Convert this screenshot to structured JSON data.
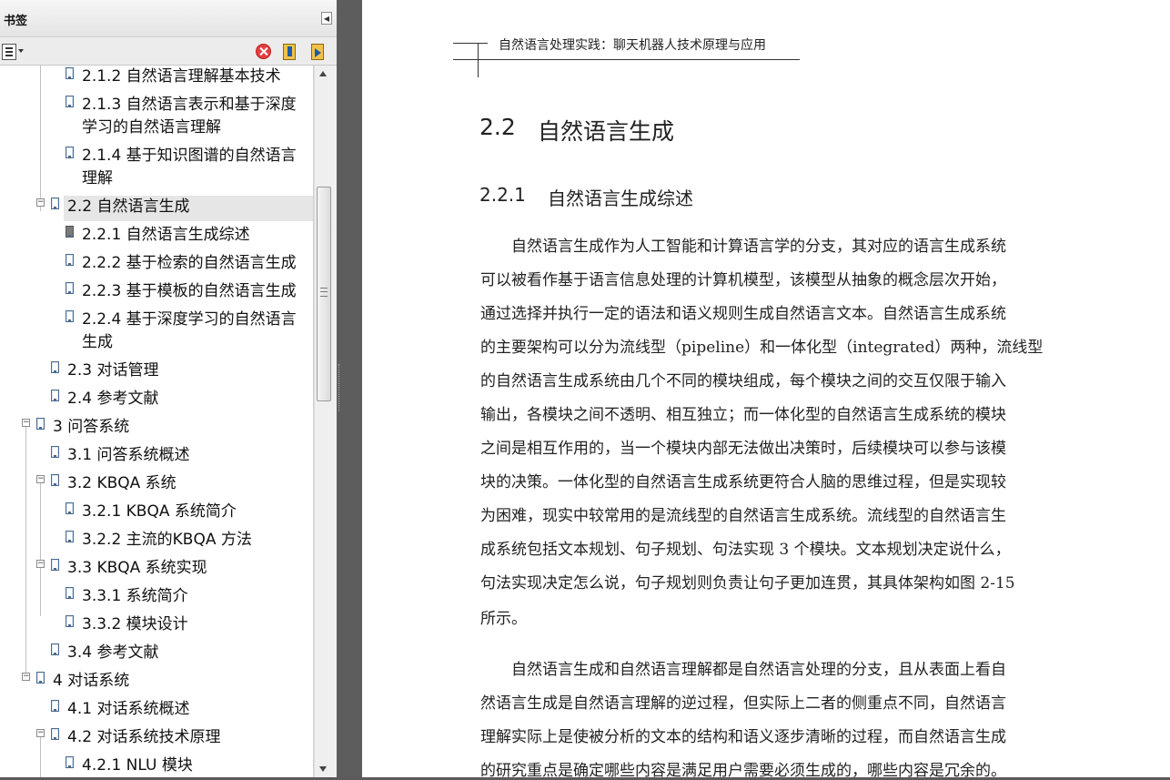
{
  "bookmarks_panel": {
    "title": "书签",
    "tree_lines": [
      "2.1.2 自然语言理解基本技术",
      "2.1.3 自然语言表示和基于深度",
      "学习的自然语言理解",
      "2.1.4 基于知识图谱的自然语言",
      "理解",
      "2.2 自然语言生成",
      "2.2.1 自然语言生成综述",
      "2.2.2 基于检索的自然语言生成",
      "2.2.3 基于模板的自然语言生成",
      "2.2.4 基于深度学习的自然语言",
      "生成",
      "2.3 对话管理",
      "2.4 参考文献",
      "3 问答系统",
      "3.1 问答系统概述",
      "3.2 KBQA 系统",
      "3.2.1 KBQA 系统简介",
      "3.2.2 主流的KBQA 方法",
      "3.3 KBQA 系统实现",
      "3.3.1 系统简介",
      "3.3.2 模块设计",
      "3.4 参考文献",
      "4 对话系统",
      "4.1 对话系统概述",
      "4.2 对话系统技术原理",
      "4.2.1 NLU 模块"
    ]
  },
  "document": {
    "running_header": "自然语言处理实践：聊天机器人技术原理与应用",
    "section_number": "2.2",
    "section_title": "自然语言生成",
    "subsection_number": "2.2.1",
    "subsection_title": "自然语言生成综述",
    "paragraph_lines": [
      "　　自然语言生成作为人工智能和计算语言学的分支，其对应的语言生成系统",
      "可以被看作基于语言信息处理的计算机模型，该模型从抽象的概念层次开始，",
      "通过选择并执行一定的语法和语义规则生成自然语言文本。自然语言生成系统",
      "的主要架构可以分为流线型（pipeline）和一体化型（integrated）两种，流线型",
      "的自然语言生成系统由几个不同的模块组成，每个模块之间的交互仅限于输入",
      "输出，各模块之间不透明、相互独立；而一体化型的自然语言生成系统的模块",
      "之间是相互作用的，当一个模块内部无法做出决策时，后续模块可以参与该模",
      "块的决策。一体化型的自然语言生成系统更符合人脑的思维过程，但是实现较",
      "为困难，现实中较常用的是流线型的自然语言生成系统。流线型的自然语言生",
      "成系统包括文本规划、句子规划、句法实现 3 个模块。文本规划决定说什么，",
      "句法实现决定怎么说，句子规划则负责让句子更加连贯，其具体架构如图 2-15",
      "所示。",
      "　　自然语言生成和自然语言理解都是自然语言处理的分支，且从表面上看自",
      "然语言生成是自然语言理解的逆过程，但实际上二者的侧重点不同，自然语言",
      "理解实际上是使被分析的文本的结构和语义逐步清晰的过程，而自然语言生成",
      "的研究重点是确定哪些内容是满足用户需要必须生成的，哪些内容是冗余的。"
    ]
  }
}
